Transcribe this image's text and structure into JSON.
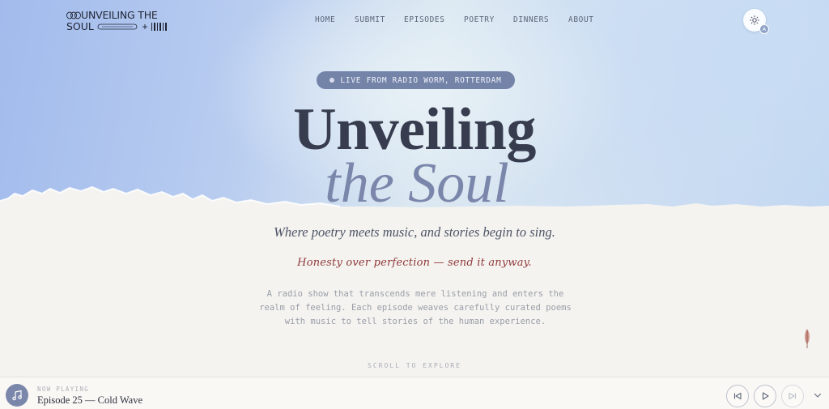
{
  "brand": {
    "line1": "UNVEILING THE",
    "line2": "SOUL"
  },
  "nav": {
    "items": [
      {
        "label": "HOME"
      },
      {
        "label": "SUBMIT"
      },
      {
        "label": "EPISODES"
      },
      {
        "label": "POETRY"
      },
      {
        "label": "DINNERS"
      },
      {
        "label": "ABOUT"
      }
    ]
  },
  "theme": {
    "icon": "sun-icon",
    "badge": "A"
  },
  "hero": {
    "live_badge": "LIVE FROM RADIO WORM, ROTTERDAM",
    "title_line1": "Unveiling",
    "title_line2": "the Soul",
    "tagline": "Where poetry meets music, and stories begin to sing.",
    "handwritten": "Honesty over perfection — send it anyway.",
    "description": "A radio show that transcends mere listening and enters the realm of feeling. Each episode weaves carefully curated poems with music to tell stories of the human experience.",
    "scroll_hint": "SCROLL TO EXPLORE"
  },
  "player": {
    "now_playing_label": "NOW PLAYING",
    "track_title": "Episode 25 — Cold Wave",
    "icons": [
      "music-note-icon",
      "skip-previous-icon",
      "play-icon",
      "skip-next-icon",
      "chevron-down-icon"
    ]
  },
  "colors": {
    "accent": "#7b86ab",
    "handwritten": "#8f3838",
    "title": "#373d4f"
  }
}
